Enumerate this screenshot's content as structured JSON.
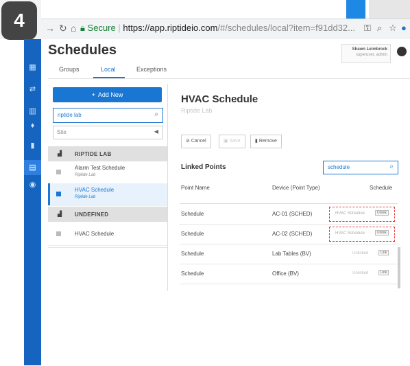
{
  "step_badge": "4",
  "browser": {
    "secure_label": "Secure",
    "url_host": "https://app.riptideio.com",
    "url_path": "/#/schedules/local?item=f91dd32..."
  },
  "header": {
    "title": "Schedules",
    "tabs": [
      {
        "label": "Groups"
      },
      {
        "label": "Local"
      },
      {
        "label": "Exceptions"
      }
    ],
    "active_tab": "Local",
    "user": {
      "name": "Shawn Leimbrock",
      "role": "superuser, admin"
    }
  },
  "left": {
    "add_label": "Add New",
    "search_value": "riptide lab",
    "site_placeholder": "Site",
    "groups": [
      {
        "name": "RIPTIDE LAB",
        "items": [
          {
            "name": "Alarm Test Schedule",
            "sub": "Riptide Lab"
          },
          {
            "name": "HVAC Schedule",
            "sub": "Riptide Lab"
          }
        ]
      },
      {
        "name": "UNDEFINED",
        "items": [
          {
            "name": "HVAC Schedule"
          }
        ]
      }
    ],
    "selected_item": "HVAC Schedule"
  },
  "detail": {
    "title": "HVAC Schedule",
    "subtitle": "Riptide Lab",
    "cancel_label": "Cancel",
    "save_label": "Save",
    "remove_label": "Remove",
    "linked_points_title": "Linked Points",
    "filter_value": "schedule",
    "columns": [
      "Point Name",
      "Device (Point Type)",
      "Schedule"
    ],
    "rows": [
      {
        "point": "Schedule",
        "device": "AC-01 (SCHED)",
        "schedule": "HVAC Schedule",
        "action": "Unlink"
      },
      {
        "point": "Schedule",
        "device": "AC-02 (SCHED)",
        "schedule": "HVAC Schedule",
        "action": "Unlink"
      },
      {
        "point": "Schedule",
        "device": "Lab Tables (BV)",
        "schedule": "Unlinked",
        "action": "Link"
      },
      {
        "point": "Schedule",
        "device": "Office (BV)",
        "schedule": "Unlinked",
        "action": "Link"
      }
    ]
  },
  "colors": {
    "accent": "#1976d2",
    "rail": "#1565c0",
    "highlight": "#e53935"
  }
}
